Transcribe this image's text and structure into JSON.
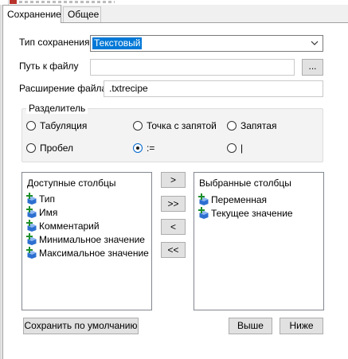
{
  "window": {
    "app_icon": "m-app-icon"
  },
  "tabs": [
    {
      "label": "Сохранение",
      "active": true
    },
    {
      "label": "Общее",
      "active": false
    }
  ],
  "form": {
    "save_type": {
      "label": "Тип сохранения",
      "value": "Текстовый",
      "options": [
        "Текстовый"
      ]
    },
    "file_path": {
      "label": "Путь к файлу",
      "value": "",
      "browse_label": "..."
    },
    "file_ext": {
      "label": "Расширение файла",
      "value": ".txtrecipe"
    }
  },
  "separator": {
    "label": "Разделитель",
    "options": [
      {
        "label": "Табуляция",
        "checked": false
      },
      {
        "label": "Точка с запятой",
        "checked": false
      },
      {
        "label": "Запятая",
        "checked": false
      },
      {
        "label": "Пробел",
        "checked": false
      },
      {
        "label": ":=",
        "checked": true
      },
      {
        "label": "|",
        "checked": false
      }
    ]
  },
  "available": {
    "header": "Доступные столбцы",
    "items": [
      "Тип",
      "Имя",
      "Комментарий",
      "Минимальное значение",
      "Максимальное значение"
    ]
  },
  "selected": {
    "header": "Выбранные столбцы",
    "items": [
      "Переменная",
      "Текущее значение"
    ]
  },
  "move_buttons": {
    "add": ">",
    "add_all": ">>",
    "remove": "<",
    "remove_all": "<<"
  },
  "footer": {
    "save_default": "Сохранить по умолчанию",
    "up": "Выше",
    "down": "Ниже"
  },
  "colors": {
    "accent": "#0078d7",
    "icon_plus": "#1c8f2a",
    "icon_cube": "#2d6fd0"
  },
  "icons": {
    "column_item": "add-column-cube-icon",
    "dropdown": "chevron-down-icon"
  }
}
